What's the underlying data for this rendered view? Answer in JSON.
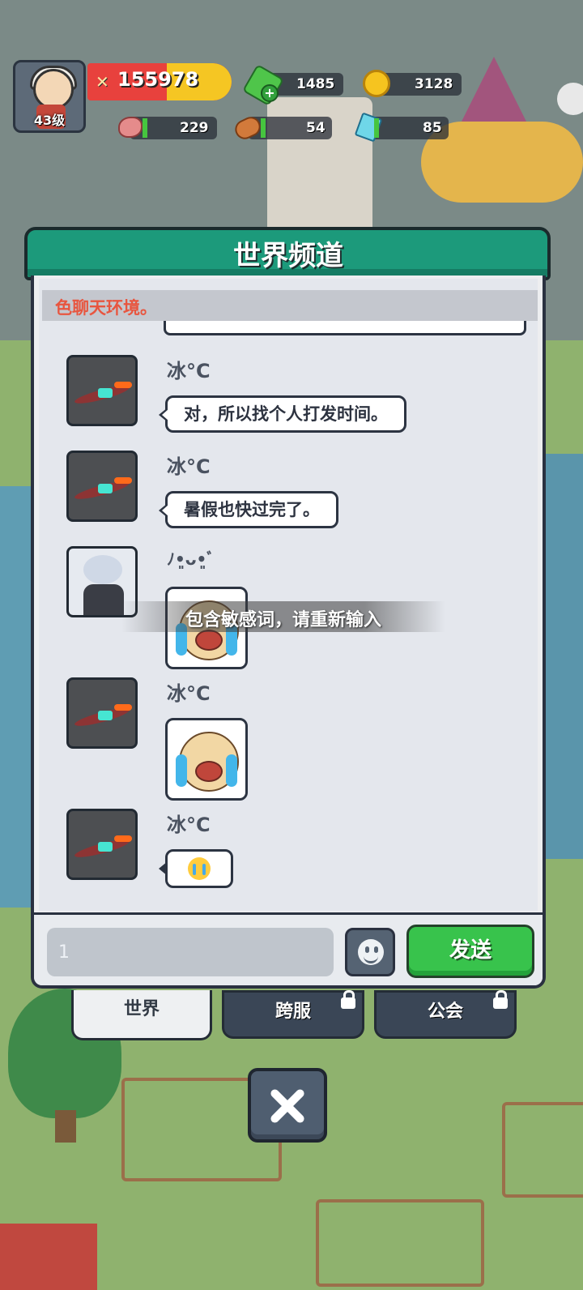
{
  "hud": {
    "level": "43级",
    "power": "155978",
    "gems": "1485",
    "coins": "3128",
    "meat": "229",
    "wood": "54",
    "crystal": "85"
  },
  "panel": {
    "title": "世界频道",
    "notice": "色聊天环境。"
  },
  "messages": [
    {
      "name": "冰°C",
      "text": "对，所以找个人打发时间。",
      "type": "text"
    },
    {
      "name": "冰°C",
      "text": "暑假也快过完了。",
      "type": "text"
    },
    {
      "name": "ﾉ•͈ᴗ•͈ﾞ",
      "type": "sticker"
    },
    {
      "name": "冰°C",
      "type": "sticker"
    },
    {
      "name": "冰°C",
      "type": "emoji",
      "emoji": "crying-face"
    }
  ],
  "toast": "包含敏感词，请重新输入",
  "input": {
    "value": "1"
  },
  "buttons": {
    "send": "发送"
  },
  "tabs": {
    "world": "世界",
    "cross_server": "跨服",
    "guild": "公会"
  },
  "colors": {
    "header": "#1c9a7b",
    "send": "#38c34c",
    "notice_text": "#e8553f"
  }
}
